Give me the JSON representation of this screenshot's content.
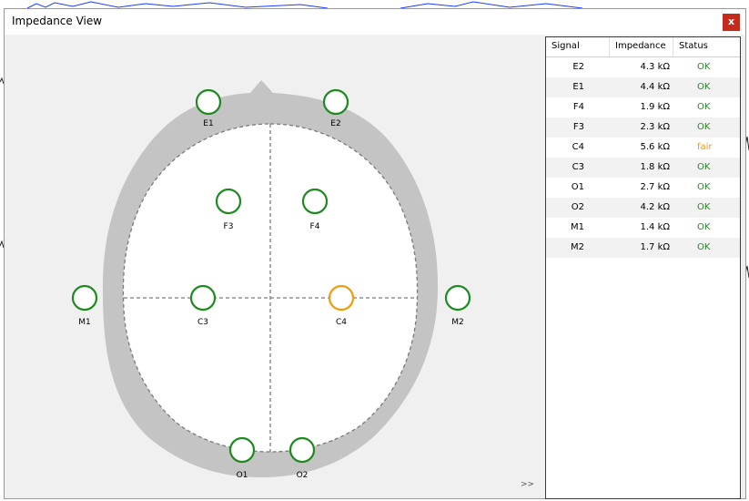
{
  "window": {
    "title": "Impedance View",
    "close_label": "x"
  },
  "electrodes": [
    {
      "label": "E1",
      "status": "ok"
    },
    {
      "label": "E2",
      "status": "ok"
    },
    {
      "label": "F3",
      "status": "ok"
    },
    {
      "label": "F4",
      "status": "ok"
    },
    {
      "label": "M1",
      "status": "ok"
    },
    {
      "label": "C3",
      "status": "ok"
    },
    {
      "label": "C4",
      "status": "fair"
    },
    {
      "label": "M2",
      "status": "ok"
    },
    {
      "label": "O1",
      "status": "ok"
    },
    {
      "label": "O2",
      "status": "ok"
    }
  ],
  "expand_label": ">>",
  "table": {
    "headers": [
      "Signal",
      "Impedance",
      "Status"
    ],
    "rows": [
      {
        "signal": "E2",
        "impedance": "4.3 kΩ",
        "status": "OK"
      },
      {
        "signal": "E1",
        "impedance": "4.4 kΩ",
        "status": "OK"
      },
      {
        "signal": "F4",
        "impedance": "1.9 kΩ",
        "status": "OK"
      },
      {
        "signal": "F3",
        "impedance": "2.3 kΩ",
        "status": "OK"
      },
      {
        "signal": "C4",
        "impedance": "5.6 kΩ",
        "status": "fair"
      },
      {
        "signal": "C3",
        "impedance": "1.8 kΩ",
        "status": "OK"
      },
      {
        "signal": "O1",
        "impedance": "2.7 kΩ",
        "status": "OK"
      },
      {
        "signal": "O2",
        "impedance": "4.2 kΩ",
        "status": "OK"
      },
      {
        "signal": "M1",
        "impedance": "1.4 kΩ",
        "status": "OK"
      },
      {
        "signal": "M2",
        "impedance": "1.7 kΩ",
        "status": "OK"
      }
    ]
  },
  "colors": {
    "ok": "#1f8a1f",
    "fair": "#f29b0c",
    "head": "#c4c4c4",
    "close": "#c42b1c"
  }
}
